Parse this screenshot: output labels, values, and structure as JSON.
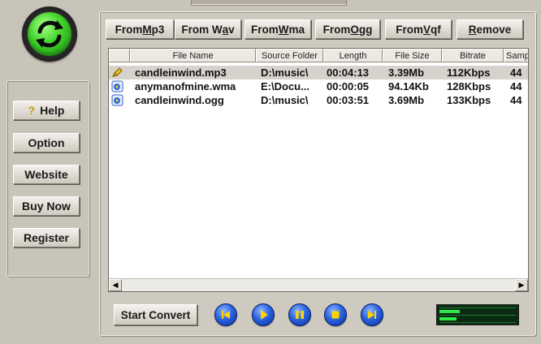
{
  "toolbar": {
    "from_mp3": {
      "pre": "From ",
      "acc": "M",
      "post": "p3"
    },
    "from_wav": {
      "pre": "From W",
      "acc": "a",
      "post": "v"
    },
    "from_wma": {
      "pre": "From ",
      "acc": "W",
      "post": "ma"
    },
    "from_ogg": {
      "pre": "From ",
      "acc": "O",
      "post": "gg"
    },
    "from_vqf": {
      "pre": "From ",
      "acc": "V",
      "post": "qf"
    },
    "remove": {
      "pre": "",
      "acc": "R",
      "post": "emove"
    }
  },
  "sidebar": {
    "help": "Help",
    "option": "Option",
    "website": "Website",
    "buy_now": "Buy Now",
    "register": "Register"
  },
  "table": {
    "columns": {
      "name": "File Name",
      "folder": "Source Folder",
      "length": "Length",
      "size": "File Size",
      "bitrate": "Bitrate",
      "sample": "Samp"
    },
    "rows": [
      {
        "name": "candleinwind.mp3",
        "folder": "D:\\music\\",
        "length": "00:04:13",
        "size": "3.39Mb",
        "bitrate": "112Kbps",
        "sample": "44",
        "icon": "mp3-file-icon"
      },
      {
        "name": "anymanofmine.wma",
        "folder": "E:\\Docu...",
        "length": "00:00:05",
        "size": "94.14Kb",
        "bitrate": "128Kbps",
        "sample": "44",
        "icon": "wma-file-icon"
      },
      {
        "name": "candleinwind.ogg",
        "folder": "D:\\music\\",
        "length": "00:03:51",
        "size": "3.69Mb",
        "bitrate": "133Kbps",
        "sample": "44",
        "icon": "ogg-file-icon"
      }
    ]
  },
  "player": {
    "start_convert": "Start Convert"
  },
  "meter": {
    "left_level": 0.27,
    "right_level": 0.22,
    "color": "#2ee84b"
  },
  "colors": {
    "background": "#c9c4b9",
    "logo_green": "#45d72e",
    "player_blue": "#2a63e0"
  }
}
